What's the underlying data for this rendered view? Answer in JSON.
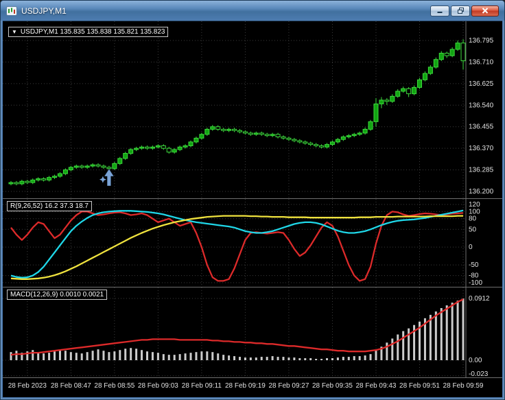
{
  "window": {
    "title": "USDJPY,M1"
  },
  "icons": {
    "app": "chart-icon",
    "minimize": "minimize-icon",
    "restore": "restore-icon",
    "close": "close-icon",
    "symbol_dropdown": "▼"
  },
  "colors": {
    "background": "#000000",
    "grid": "#3d3d3d",
    "separator": "#707070",
    "scale_text": "#e2e2e2",
    "candle_outline": "#3ddc3d",
    "candle_bull_fill": "#12a412",
    "candle_bear_fill": "#000000",
    "line_red": "#dd2a2a",
    "line_cyan": "#1fd7e8",
    "line_yellow": "#efe23e",
    "macd_histogram": "#cccccc",
    "macd_signal": "#dd2a2a",
    "arrow": "#7ba3d6",
    "titlebar": "#4d7cb0"
  },
  "main_panel": {
    "ohlc_arrow": "▼",
    "ohlc_label": "USDJPY,M1 135.835 135.838 135.821 135.823"
  },
  "time_axis": {
    "labels": [
      "28 Feb 2023",
      "28 Feb 08:47",
      "28 Feb 08:55",
      "28 Feb 09:03",
      "28 Feb 09:11",
      "28 Feb 09:19",
      "28 Feb 09:27",
      "28 Feb 09:35",
      "28 Feb 09:43",
      "28 Feb 09:51",
      "28 Feb 09:59"
    ],
    "tick_bar_indices": [
      3,
      11,
      19,
      27,
      35,
      43,
      51,
      59,
      67,
      75,
      83
    ]
  },
  "chart_data": [
    {
      "type": "candlestick",
      "symbol": "USDJPY",
      "timeframe": "M1",
      "ohlc_label": "USDJPY,M1 135.835 135.838 135.821 135.823",
      "ylim": [
        136.2,
        136.795
      ],
      "y_ticks": [
        {
          "label": "136.795",
          "value": 136.795
        },
        {
          "label": "136.710",
          "value": 136.71
        },
        {
          "label": "136.625",
          "value": 136.625
        },
        {
          "label": "136.540",
          "value": 136.54
        },
        {
          "label": "136.455",
          "value": 136.455
        },
        {
          "label": "136.370",
          "value": 136.37
        },
        {
          "label": "136.285",
          "value": 136.285
        },
        {
          "label": "136.200",
          "value": 136.2
        }
      ],
      "annotation": {
        "type": "buy-arrow",
        "bar_index": 18,
        "price": 136.282
      },
      "candles": [
        [
          136.23,
          136.241,
          136.224,
          136.235
        ],
        [
          136.235,
          136.241,
          136.224,
          136.23
        ],
        [
          136.23,
          136.246,
          136.224,
          136.24
        ],
        [
          136.24,
          136.246,
          136.229,
          136.235
        ],
        [
          136.235,
          136.251,
          136.229,
          136.245
        ],
        [
          136.245,
          136.256,
          136.239,
          136.25
        ],
        [
          136.25,
          136.256,
          136.239,
          136.245
        ],
        [
          136.245,
          136.261,
          136.239,
          136.255
        ],
        [
          136.255,
          136.266,
          136.249,
          136.26
        ],
        [
          136.26,
          136.276,
          136.254,
          136.27
        ],
        [
          136.27,
          136.291,
          136.264,
          136.285
        ],
        [
          136.285,
          136.301,
          136.279,
          136.295
        ],
        [
          136.295,
          136.306,
          136.289,
          136.3
        ],
        [
          136.3,
          136.306,
          136.289,
          136.295
        ],
        [
          136.295,
          136.306,
          136.289,
          136.3
        ],
        [
          136.3,
          136.311,
          136.294,
          136.305
        ],
        [
          136.305,
          136.311,
          136.294,
          136.3
        ],
        [
          136.3,
          136.306,
          136.289,
          136.295
        ],
        [
          136.295,
          136.301,
          136.278,
          136.29
        ],
        [
          136.29,
          136.316,
          136.284,
          136.31
        ],
        [
          136.31,
          136.336,
          136.304,
          136.33
        ],
        [
          136.33,
          136.356,
          136.324,
          136.35
        ],
        [
          136.35,
          136.371,
          136.344,
          136.365
        ],
        [
          136.365,
          136.376,
          136.359,
          136.37
        ],
        [
          136.37,
          136.381,
          136.364,
          136.375
        ],
        [
          136.375,
          136.381,
          136.364,
          136.37
        ],
        [
          136.37,
          136.381,
          136.364,
          136.375
        ],
        [
          136.375,
          136.386,
          136.369,
          136.38
        ],
        [
          136.38,
          136.386,
          136.364,
          136.37
        ],
        [
          136.37,
          136.376,
          136.349,
          136.355
        ],
        [
          136.355,
          136.371,
          136.349,
          136.365
        ],
        [
          136.365,
          136.381,
          136.359,
          136.375
        ],
        [
          136.375,
          136.386,
          136.369,
          136.38
        ],
        [
          136.38,
          136.401,
          136.374,
          136.395
        ],
        [
          136.395,
          136.416,
          136.389,
          136.41
        ],
        [
          136.41,
          136.431,
          136.404,
          136.425
        ],
        [
          136.425,
          136.451,
          136.419,
          136.445
        ],
        [
          136.445,
          136.462,
          136.439,
          136.455
        ],
        [
          136.455,
          136.461,
          136.439,
          136.445
        ],
        [
          136.445,
          136.451,
          136.434,
          136.44
        ],
        [
          136.44,
          136.451,
          136.434,
          136.445
        ],
        [
          136.445,
          136.451,
          136.434,
          136.44
        ],
        [
          136.44,
          136.446,
          136.429,
          136.435
        ],
        [
          136.435,
          136.441,
          136.424,
          136.43
        ],
        [
          136.43,
          136.436,
          136.419,
          136.425
        ],
        [
          136.425,
          136.436,
          136.419,
          136.43
        ],
        [
          136.43,
          136.436,
          136.419,
          136.425
        ],
        [
          136.425,
          136.431,
          136.414,
          136.42
        ],
        [
          136.42,
          136.431,
          136.414,
          136.425
        ],
        [
          136.425,
          136.431,
          136.409,
          136.415
        ],
        [
          136.415,
          136.421,
          136.404,
          136.41
        ],
        [
          136.41,
          136.416,
          136.399,
          136.405
        ],
        [
          136.405,
          136.411,
          136.394,
          136.4
        ],
        [
          136.4,
          136.406,
          136.389,
          136.395
        ],
        [
          136.395,
          136.401,
          136.384,
          136.39
        ],
        [
          136.39,
          136.396,
          136.379,
          136.385
        ],
        [
          136.385,
          136.391,
          136.374,
          136.38
        ],
        [
          136.38,
          136.386,
          136.369,
          136.375
        ],
        [
          136.375,
          136.391,
          136.369,
          136.385
        ],
        [
          136.385,
          136.401,
          136.379,
          136.395
        ],
        [
          136.395,
          136.411,
          136.389,
          136.405
        ],
        [
          136.405,
          136.421,
          136.399,
          136.415
        ],
        [
          136.415,
          136.426,
          136.409,
          136.42
        ],
        [
          136.42,
          136.431,
          136.414,
          136.425
        ],
        [
          136.425,
          136.436,
          136.419,
          136.43
        ],
        [
          136.43,
          136.452,
          136.424,
          136.445
        ],
        [
          136.445,
          136.482,
          136.439,
          136.475
        ],
        [
          136.475,
          136.568,
          136.455,
          136.545
        ],
        [
          136.545,
          136.572,
          136.528,
          136.56
        ],
        [
          136.56,
          136.568,
          136.541,
          136.555
        ],
        [
          136.555,
          136.583,
          136.549,
          136.575
        ],
        [
          136.575,
          136.603,
          136.569,
          136.595
        ],
        [
          136.595,
          136.613,
          136.589,
          136.605
        ],
        [
          136.605,
          136.611,
          136.572,
          136.585
        ],
        [
          136.585,
          136.618,
          136.579,
          136.61
        ],
        [
          136.61,
          136.648,
          136.604,
          136.64
        ],
        [
          136.64,
          136.673,
          136.634,
          136.665
        ],
        [
          136.665,
          136.698,
          136.659,
          136.69
        ],
        [
          136.69,
          136.728,
          136.684,
          136.72
        ],
        [
          136.72,
          136.753,
          136.714,
          136.745
        ],
        [
          136.745,
          136.751,
          136.726,
          136.735
        ],
        [
          136.735,
          136.768,
          136.729,
          136.76
        ],
        [
          136.76,
          136.795,
          136.754,
          136.785
        ],
        [
          136.785,
          136.8,
          136.68,
          136.715
        ]
      ]
    },
    {
      "type": "line",
      "title": "R(9,26,52) 16.2 37.3 18.7",
      "ylim": [
        -100,
        120
      ],
      "y_ticks": [
        {
          "label": "120",
          "value": 120
        },
        {
          "label": "100",
          "value": 100
        },
        {
          "label": "80",
          "value": 80
        },
        {
          "label": "50",
          "value": 50
        },
        {
          "label": "0",
          "value": 0
        },
        {
          "label": "-50",
          "value": -50
        },
        {
          "label": "-80",
          "value": -80
        },
        {
          "label": "-100",
          "value": -100
        }
      ],
      "series": [
        {
          "name": "fast-line",
          "color_key": "line_red",
          "values": [
            55,
            35,
            20,
            35,
            55,
            70,
            65,
            45,
            25,
            35,
            55,
            75,
            90,
            100,
            100,
            95,
            90,
            92,
            95,
            97,
            98,
            95,
            90,
            92,
            95,
            90,
            80,
            70,
            75,
            80,
            70,
            60,
            65,
            70,
            40,
            0,
            -50,
            -85,
            -95,
            -95,
            -90,
            -60,
            -20,
            20,
            40,
            42,
            40,
            38,
            40,
            42,
            40,
            20,
            -5,
            -25,
            -15,
            5,
            30,
            55,
            70,
            60,
            30,
            -10,
            -50,
            -80,
            -95,
            -90,
            -55,
            10,
            60,
            90,
            100,
            98,
            92,
            88,
            90,
            93,
            95,
            94,
            92,
            90,
            92,
            94,
            95,
            96
          ]
        },
        {
          "name": "mid-line",
          "color_key": "line_cyan",
          "values": [
            -80,
            -84,
            -86,
            -85,
            -80,
            -70,
            -55,
            -35,
            -15,
            5,
            25,
            45,
            60,
            72,
            82,
            90,
            95,
            98,
            100,
            101,
            102,
            102,
            102,
            101,
            100,
            99,
            97,
            95,
            92,
            88,
            84,
            80,
            76,
            73,
            70,
            68,
            66,
            64,
            62,
            60,
            58,
            55,
            50,
            45,
            42,
            40,
            40,
            42,
            45,
            50,
            55,
            60,
            65,
            68,
            70,
            70,
            68,
            64,
            58,
            52,
            46,
            42,
            40,
            40,
            42,
            45,
            50,
            56,
            62,
            67,
            71,
            74,
            76,
            77,
            78,
            80,
            82,
            85,
            88,
            91,
            94,
            97,
            100,
            103
          ]
        },
        {
          "name": "slow-line",
          "color_key": "line_yellow",
          "values": [
            -88,
            -89,
            -90,
            -90,
            -89,
            -88,
            -86,
            -83,
            -79,
            -74,
            -68,
            -61,
            -54,
            -46,
            -38,
            -30,
            -22,
            -14,
            -6,
            2,
            10,
            18,
            26,
            33,
            40,
            46,
            52,
            57,
            62,
            66,
            70,
            73,
            76,
            79,
            81,
            83,
            85,
            86,
            87,
            88,
            88,
            88,
            88,
            88,
            87,
            87,
            86,
            86,
            85,
            85,
            85,
            84,
            84,
            84,
            84,
            83,
            83,
            83,
            83,
            83,
            83,
            83,
            83,
            83,
            84,
            84,
            84,
            85,
            85,
            85,
            85,
            86,
            86,
            86,
            86,
            86,
            86,
            87,
            87,
            87,
            87,
            87,
            88,
            88
          ]
        }
      ]
    },
    {
      "type": "macd",
      "title": "MACD(12,26,9) 0.0010 0.0021",
      "ylim": [
        -0.023,
        0.0912
      ],
      "y_ticks": [
        {
          "label": "0.0912",
          "value": 0.0912
        },
        {
          "label": "0.00",
          "value": 0
        },
        {
          "label": "-0.023",
          "value": -0.023
        }
      ],
      "histogram": [
        0.012,
        0.014,
        0.011,
        0.013,
        0.015,
        0.012,
        0.01,
        0.011,
        0.013,
        0.015,
        0.014,
        0.012,
        0.011,
        0.01,
        0.012,
        0.014,
        0.016,
        0.014,
        0.012,
        0.013,
        0.015,
        0.017,
        0.018,
        0.017,
        0.015,
        0.013,
        0.012,
        0.011,
        0.009,
        0.008,
        0.008,
        0.009,
        0.01,
        0.011,
        0.012,
        0.013,
        0.013,
        0.012,
        0.01,
        0.008,
        0.007,
        0.006,
        0.005,
        0.004,
        0.004,
        0.004,
        0.005,
        0.005,
        0.006,
        0.005,
        0.005,
        0.004,
        0.004,
        0.003,
        0.003,
        0.003,
        0.002,
        0.002,
        0.003,
        0.003,
        0.004,
        0.005,
        0.005,
        0.006,
        0.006,
        0.007,
        0.009,
        0.014,
        0.02,
        0.026,
        0.032,
        0.038,
        0.043,
        0.047,
        0.052,
        0.057,
        0.062,
        0.067,
        0.072,
        0.077,
        0.081,
        0.085,
        0.088,
        0.091
      ],
      "signal": [
        0.008,
        0.009,
        0.009,
        0.01,
        0.011,
        0.011,
        0.012,
        0.013,
        0.014,
        0.015,
        0.016,
        0.017,
        0.018,
        0.019,
        0.02,
        0.021,
        0.022,
        0.023,
        0.024,
        0.025,
        0.026,
        0.027,
        0.028,
        0.029,
        0.03,
        0.03,
        0.031,
        0.031,
        0.031,
        0.031,
        0.031,
        0.03,
        0.03,
        0.03,
        0.03,
        0.03,
        0.03,
        0.029,
        0.029,
        0.028,
        0.028,
        0.027,
        0.027,
        0.026,
        0.026,
        0.025,
        0.025,
        0.024,
        0.024,
        0.023,
        0.022,
        0.021,
        0.021,
        0.02,
        0.019,
        0.018,
        0.017,
        0.016,
        0.016,
        0.015,
        0.014,
        0.014,
        0.013,
        0.013,
        0.013,
        0.013,
        0.014,
        0.015,
        0.017,
        0.02,
        0.024,
        0.028,
        0.033,
        0.038,
        0.043,
        0.048,
        0.054,
        0.06,
        0.066,
        0.071,
        0.076,
        0.081,
        0.086,
        0.09
      ]
    }
  ]
}
